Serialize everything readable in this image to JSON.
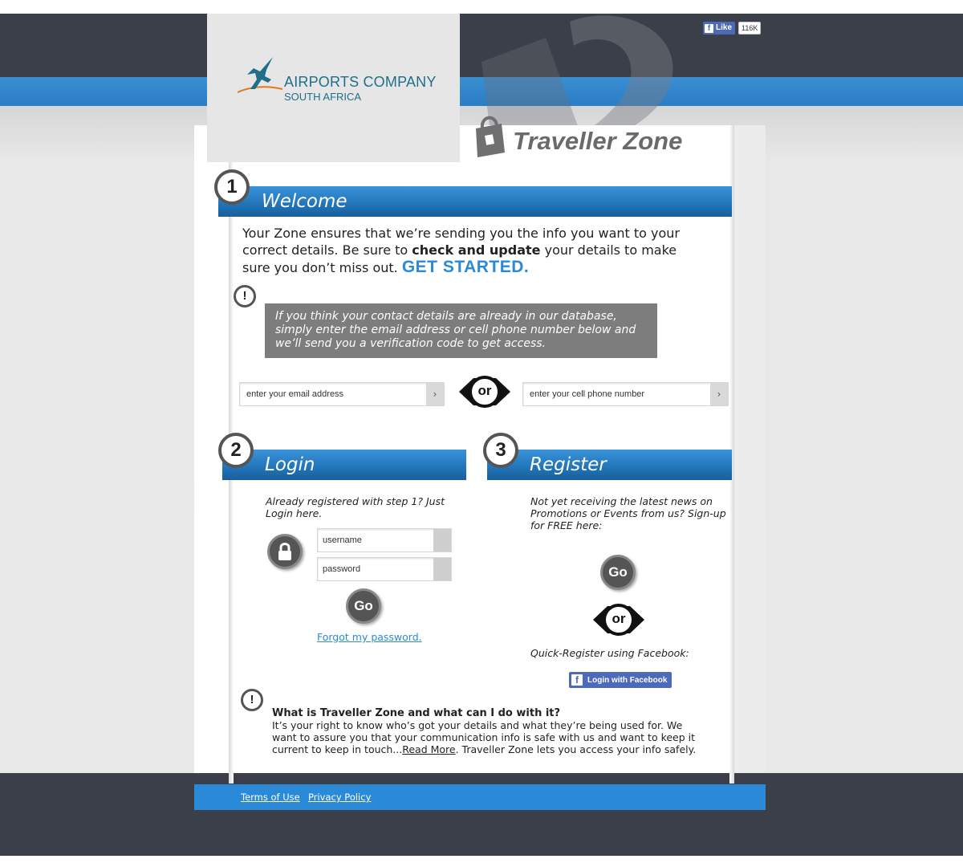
{
  "header": {
    "logo_title": "AIRPORTS COMPANY",
    "logo_subtitle": "SOUTH AFRICA",
    "fb_like_label": "Like",
    "fb_like_count": "116K",
    "zone_title": "Traveller Zone"
  },
  "welcome": {
    "step": "1",
    "title": "Welcome",
    "intro_part1": "Your Zone ensures that we’re sending you the info you want to your correct details. Be sure to ",
    "intro_bold": "check and update",
    "intro_part2": " your details to make sure you don’t miss out. ",
    "get_started": "GET STARTED.",
    "notice_icon": "!",
    "notice": "If you think your contact details are already in our database, simply enter the email address or cell phone number below and we’ll send you a verification code to get access.",
    "email_placeholder": "enter your email address",
    "phone_placeholder": "enter your cell phone number",
    "arrow": "›",
    "or_label": "or"
  },
  "login": {
    "step": "2",
    "title": "Login",
    "description": "Already registered with step 1? Just Login here.",
    "username_placeholder": "username",
    "password_placeholder": "password",
    "go_label": "Go",
    "forgot_label": "Forgot my password."
  },
  "register": {
    "step": "3",
    "title": "Register",
    "description": "Not yet receiving the latest news on Promotions or Events from us? Sign-up for FREE here:",
    "go_label": "Go",
    "or_label": "or",
    "quick_register": "Quick-Register using Facebook:",
    "fb_button_label": "Login with Facebook"
  },
  "about": {
    "icon": "!",
    "title": "What is Traveller Zone and what can I do with it?",
    "text_part1": "It’s your right to know who’s got your details and what they’re being used for. We want to assure you that your communication info is safe with us and want to keep it current to keep in touch...",
    "read_more": "Read More",
    "text_part2": ". Traveller Zone lets you access your info safely."
  },
  "footer": {
    "terms": "Terms of Use",
    "privacy": "Privacy Policy"
  },
  "colors": {
    "dark_band": "#3a3f49",
    "brand_blue": "#2b8ad8",
    "logo_teal": "#1f6f8b"
  }
}
